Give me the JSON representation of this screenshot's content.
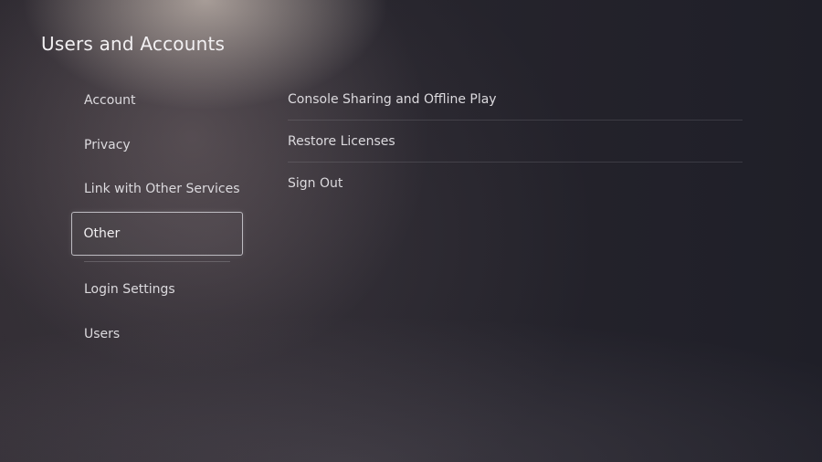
{
  "header": {
    "title": "Users and Accounts"
  },
  "sidebar": {
    "items": [
      {
        "label": "Account",
        "selected": false
      },
      {
        "label": "Privacy",
        "selected": false
      },
      {
        "label": "Link with Other Services",
        "selected": false
      },
      {
        "label": "Other",
        "selected": true
      }
    ],
    "items_after_divider": [
      {
        "label": "Login Settings"
      },
      {
        "label": "Users"
      }
    ]
  },
  "main": {
    "options": [
      {
        "label": "Console Sharing and Offline Play"
      },
      {
        "label": "Restore Licenses"
      },
      {
        "label": "Sign Out"
      }
    ]
  },
  "colors": {
    "background": "#27252e",
    "text": "#dcdade",
    "selection_border": "#bdbbc1"
  }
}
